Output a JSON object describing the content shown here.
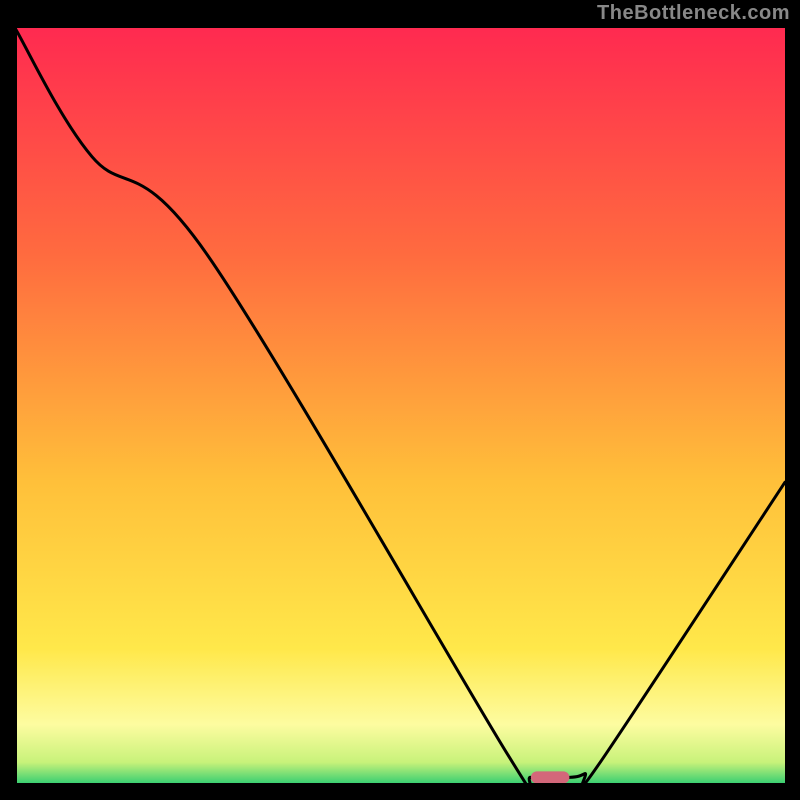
{
  "watermark": "TheBottleneck.com",
  "chart_data": {
    "type": "line",
    "title": "",
    "xlabel": "",
    "ylabel": "",
    "xlim": [
      0,
      100
    ],
    "ylim": [
      0,
      100
    ],
    "series": [
      {
        "name": "bottleneck-curve",
        "x": [
          0,
          10,
          25,
          64,
          67,
          72,
          74,
          76,
          100
        ],
        "values": [
          100,
          83,
          70,
          4,
          1,
          1,
          1.5,
          3,
          40
        ]
      }
    ],
    "annotations": [
      {
        "name": "optimal-marker",
        "x_start": 67,
        "x_end": 72,
        "y": 1,
        "color": "#d3677a"
      }
    ],
    "background_gradient": {
      "stops": [
        {
          "offset": 0,
          "color": "#ff2a50"
        },
        {
          "offset": 0.3,
          "color": "#ff6b3f"
        },
        {
          "offset": 0.6,
          "color": "#ffc03a"
        },
        {
          "offset": 0.82,
          "color": "#ffe84a"
        },
        {
          "offset": 0.92,
          "color": "#fdfca0"
        },
        {
          "offset": 0.97,
          "color": "#c8f27a"
        },
        {
          "offset": 1.0,
          "color": "#2ecc71"
        }
      ]
    },
    "frame": {
      "left": true,
      "bottom": true,
      "right": false,
      "top": false
    }
  }
}
